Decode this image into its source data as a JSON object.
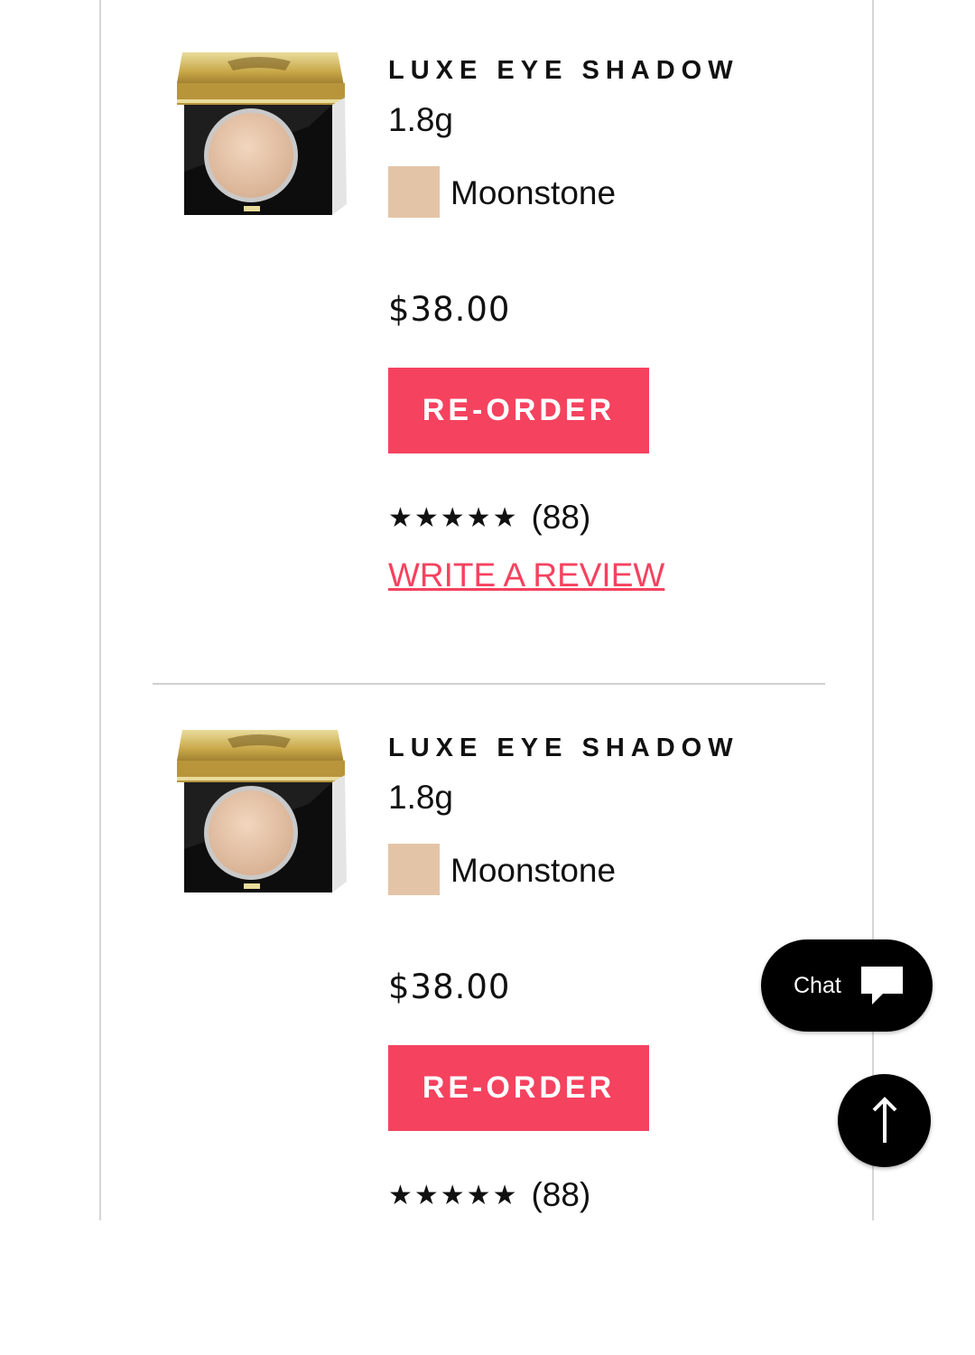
{
  "theme": {
    "accent": "#f5425f",
    "swatch_moonstone": "#e4c4a6"
  },
  "items": [
    {
      "name": "LUXE EYE SHADOW",
      "size": "1.8g",
      "shade": "Moonstone",
      "price": "$38.00",
      "reorder_label": "RE-ORDER",
      "stars": "★★★★★",
      "rating_count": "(88)",
      "review_link": "WRITE A REVIEW"
    },
    {
      "name": "LUXE EYE SHADOW",
      "size": "1.8g",
      "shade": "Moonstone",
      "price": "$38.00",
      "reorder_label": "RE-ORDER",
      "stars": "★★★★★",
      "rating_count": "(88)"
    }
  ],
  "chat": {
    "label": "Chat"
  }
}
